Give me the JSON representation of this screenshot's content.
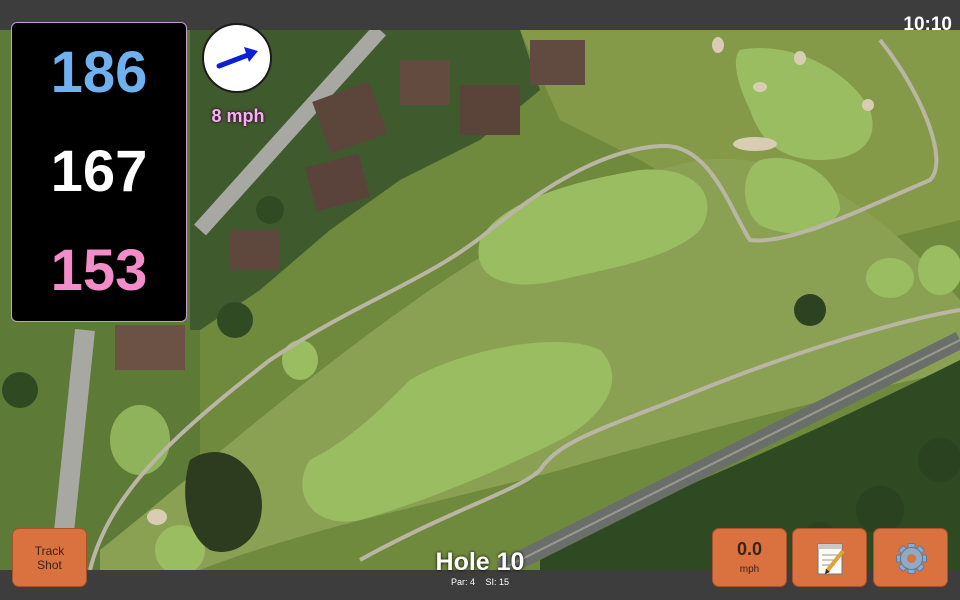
{
  "status_bar": {
    "time": "10:10"
  },
  "distances": {
    "back": "186",
    "middle": "167",
    "front": "153"
  },
  "wind": {
    "speed_label": "8 mph",
    "direction_icon": "arrow-icon",
    "arrow_color": "#0a1fd6"
  },
  "hole": {
    "title": "Hole 10",
    "par": "Par: 4",
    "stroke_index": "SI: 15"
  },
  "buttons": {
    "track_shot_line1": "Track",
    "track_shot_line2": "Shot",
    "wind_value": "0.0",
    "wind_unit": "mph",
    "notes_icon": "notepad-icon",
    "settings_icon": "gear-icon"
  },
  "colors": {
    "accent_button": "#d9723f",
    "distance_back": "#6fb0ee",
    "distance_middle": "#ffffff",
    "distance_front": "#f28dca",
    "wind_label": "#f0b4ea"
  }
}
